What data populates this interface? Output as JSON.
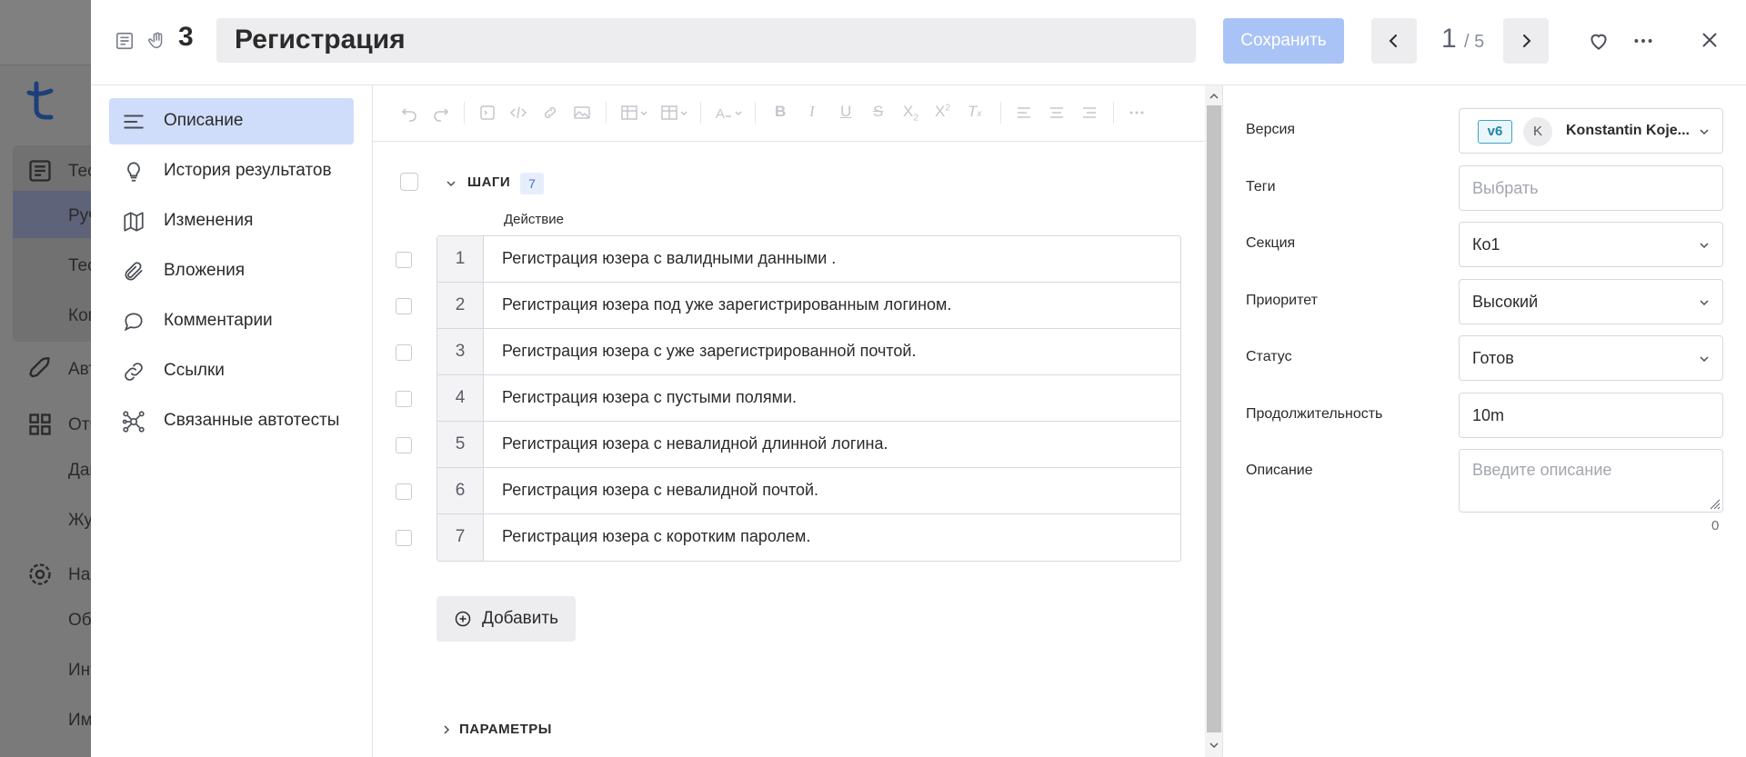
{
  "background": {
    "logo": "t-logo",
    "items": [
      {
        "label": "Тес",
        "top": 0
      },
      {
        "label": "Руч"
      },
      {
        "label": "Тес"
      },
      {
        "label": "Ком"
      },
      {
        "label": "Авт"
      },
      {
        "label": "Отч"
      },
      {
        "label": "Дап"
      },
      {
        "label": "Жур"
      },
      {
        "label": "Нас"
      },
      {
        "label": "Об"
      },
      {
        "label": "Инт"
      },
      {
        "label": "Им"
      }
    ]
  },
  "header": {
    "case_id": "3",
    "title": "Регистрация",
    "save_label": "Сохранить",
    "pager_current": "1",
    "pager_total": "/ 5"
  },
  "nav": {
    "items": [
      {
        "label": "Описание",
        "icon": "description-icon",
        "active": true
      },
      {
        "label": "История результатов",
        "icon": "lightbulb-icon"
      },
      {
        "label": "Изменения",
        "icon": "map-icon"
      },
      {
        "label": "Вложения",
        "icon": "paperclip-icon"
      },
      {
        "label": "Комментарии",
        "icon": "comment-icon"
      },
      {
        "label": "Ссылки",
        "icon": "link-icon"
      },
      {
        "label": "Связанные автотесты",
        "icon": "nodes-icon"
      }
    ]
  },
  "steps": {
    "title": "ШАГИ",
    "count": "7",
    "column_header": "Действие",
    "rows": [
      {
        "num": "1",
        "text": "Регистрация юзера с валидными данными ."
      },
      {
        "num": "2",
        "text": "Регистрация юзера под уже зарегистрированным логином."
      },
      {
        "num": "3",
        "text": "Регистрация юзера с уже зарегистрированной почтой."
      },
      {
        "num": "4",
        "text": "Регистрация юзера с пустыми полями."
      },
      {
        "num": "5",
        "text": "Регистрация юзера с невалидной длинной логина."
      },
      {
        "num": "6",
        "text": "Регистрация юзера с невалидной почтой."
      },
      {
        "num": "7",
        "text": "Регистрация юзера с коротким паролем."
      }
    ],
    "add_label": "Добавить"
  },
  "params": {
    "title": "ПАРАМЕТРЫ"
  },
  "fields": {
    "version_label": "Версия",
    "version_badge": "v6",
    "version_avatar": "K",
    "version_user": "Konstantin Koje...",
    "tags_label": "Теги",
    "tags_placeholder": "Выбрать",
    "section_label": "Секция",
    "section_value": "Ко1",
    "priority_label": "Приоритет",
    "priority_value": "Высокий",
    "status_label": "Статус",
    "status_value": "Готов",
    "duration_label": "Продолжительность",
    "duration_value": "10m",
    "description_label": "Описание",
    "description_placeholder": "Введите описание",
    "description_count": "0"
  },
  "colors": {
    "accent": "#3d6fd8",
    "save_disabled": "#a9c3f6",
    "nav_active": "#cfddfa"
  }
}
